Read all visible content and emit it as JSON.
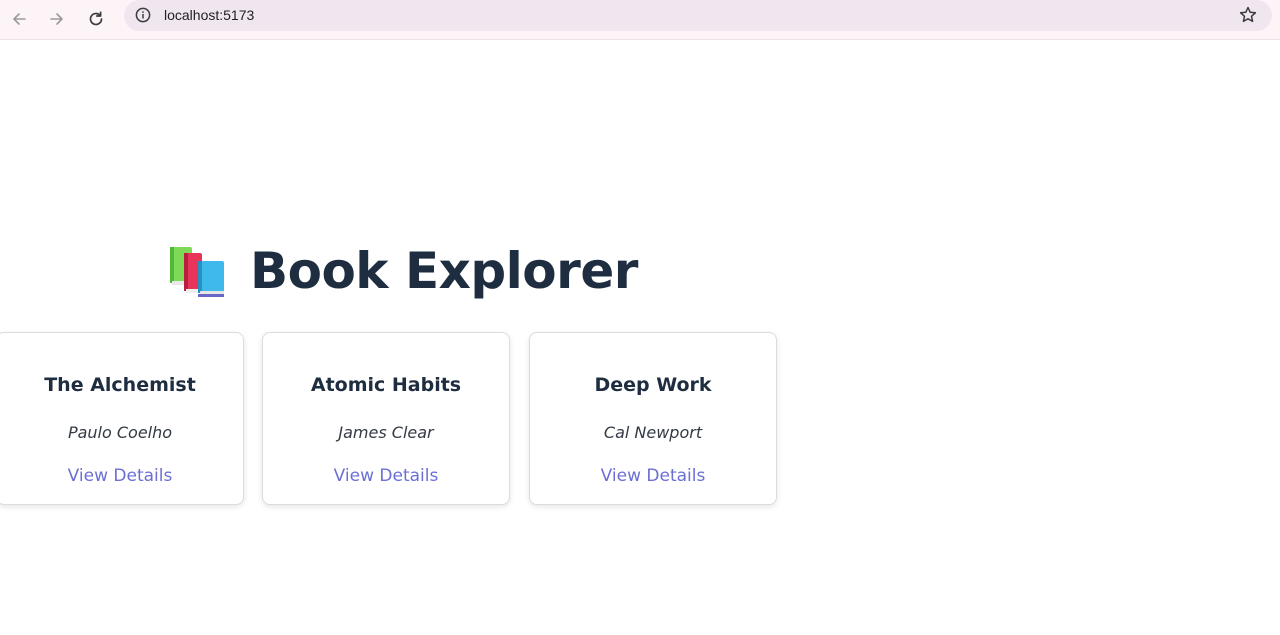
{
  "browser": {
    "url": "localhost:5173",
    "icons": [
      "back-arrow-icon",
      "forward-arrow-icon",
      "reload-icon",
      "info-icon",
      "star-icon"
    ]
  },
  "header": {
    "icon": "books-emoji-icon",
    "title": "Book Explorer"
  },
  "books": [
    {
      "title": "The Alchemist",
      "author": "Paulo Coelho",
      "link_label": "View Details"
    },
    {
      "title": "Atomic Habits",
      "author": "James Clear",
      "link_label": "View Details"
    },
    {
      "title": "Deep Work",
      "author": "Cal Newport",
      "link_label": "View Details"
    }
  ],
  "colors": {
    "title": "#1e2d40",
    "link": "#6b6fd4",
    "card_border": "#dcdcdc"
  }
}
